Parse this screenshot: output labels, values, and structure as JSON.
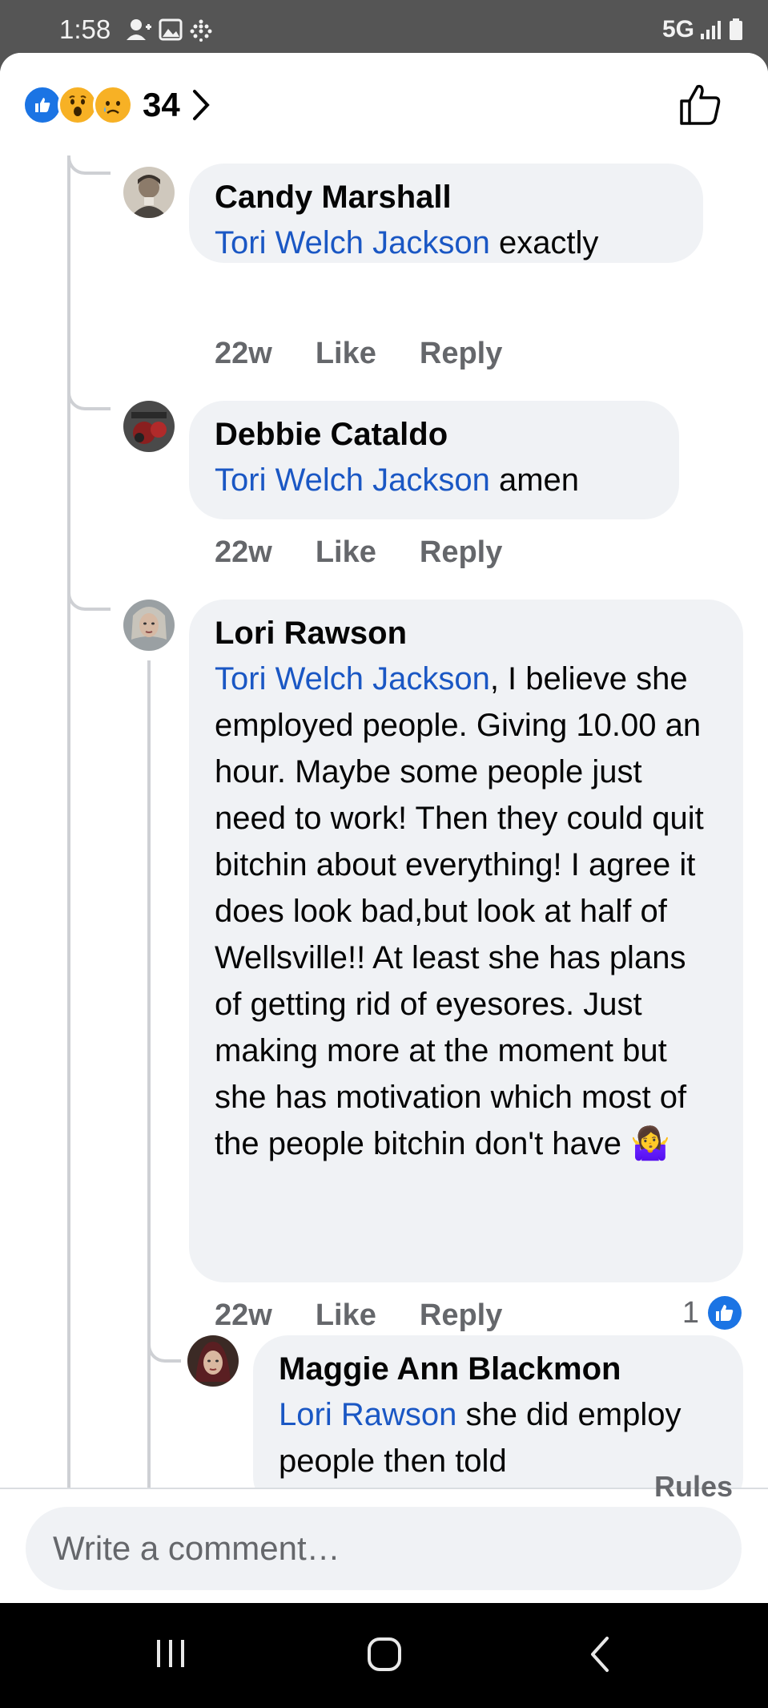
{
  "status_bar": {
    "time": "1:58",
    "network": "5G"
  },
  "reactions": {
    "count": "34",
    "types": [
      "like-icon",
      "wow-icon",
      "sad-icon"
    ]
  },
  "comments": [
    {
      "author": "Candy Marshall",
      "mention": "Tori Welch Jackson",
      "text": " exactly",
      "age": "22w",
      "like_label": "Like",
      "reply_label": "Reply"
    },
    {
      "author": "Debbie Cataldo",
      "mention": "Tori Welch Jackson",
      "text": " amen",
      "age": "22w",
      "like_label": "Like",
      "reply_label": "Reply"
    },
    {
      "author": "Lori Rawson",
      "mention": "Tori Welch Jackson",
      "text": ", I believe she employed people. Giving 10.00 an hour. Maybe some people just need to work! Then they could quit bitchin about everything! I agree it does look bad,but look at half of Wellsville!! At least she has plans of getting rid of eyesores. Just making more at the moment but she has motivation which most of the people bitchin don't have 🤷‍♀️",
      "age": "22w",
      "like_label": "Like",
      "reply_label": "Reply",
      "reaction_count": "1"
    },
    {
      "author": "Maggie Ann Blackmon",
      "mention": "Lori Rawson",
      "text": " she did employ people then told",
      "age": "",
      "like_label": "",
      "reply_label": ""
    }
  ],
  "footer": {
    "rules_label": "Rules",
    "composer_placeholder": "Write a comment…"
  },
  "colors": {
    "mention": "#1a57c4",
    "bubble": "#f0f2f5",
    "meta": "#65676b",
    "like_blue": "#1b74e4"
  }
}
